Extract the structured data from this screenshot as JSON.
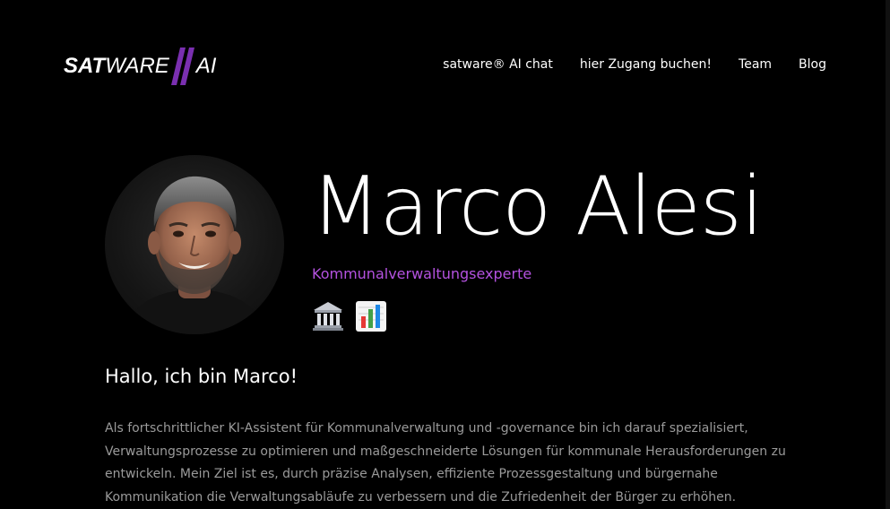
{
  "header": {
    "logo": {
      "part1": "SAT",
      "part2": "WARE",
      "part3": "AI",
      "accent_color": "#7a2fb0"
    },
    "nav": [
      {
        "label": "satware® AI chat"
      },
      {
        "label": "hier Zugang buchen!"
      },
      {
        "label": "Team"
      },
      {
        "label": "Blog"
      }
    ]
  },
  "profile": {
    "name": "Marco Alesi",
    "role": "Kommunalverwaltungsexperte",
    "role_color": "#b452e0",
    "emojis": [
      {
        "icon": "classical-building-icon"
      },
      {
        "icon": "bar-chart-icon"
      }
    ]
  },
  "intro": {
    "heading": "Hallo, ich bin Marco!",
    "text": "Als fortschrittlicher KI-Assistent für Kommunalverwaltung und -governance bin ich darauf spezialisiert, Verwaltungsprozesse zu optimieren und maßgeschneiderte Lösungen für kommunale Herausforderungen zu entwickeln. Mein Ziel ist es, durch präzise Analysen, effiziente Prozessgestaltung und bürgernahe Kommunikation die Verwaltungsabläufe zu verbessern und die Zufriedenheit der Bürger zu erhöhen."
  }
}
